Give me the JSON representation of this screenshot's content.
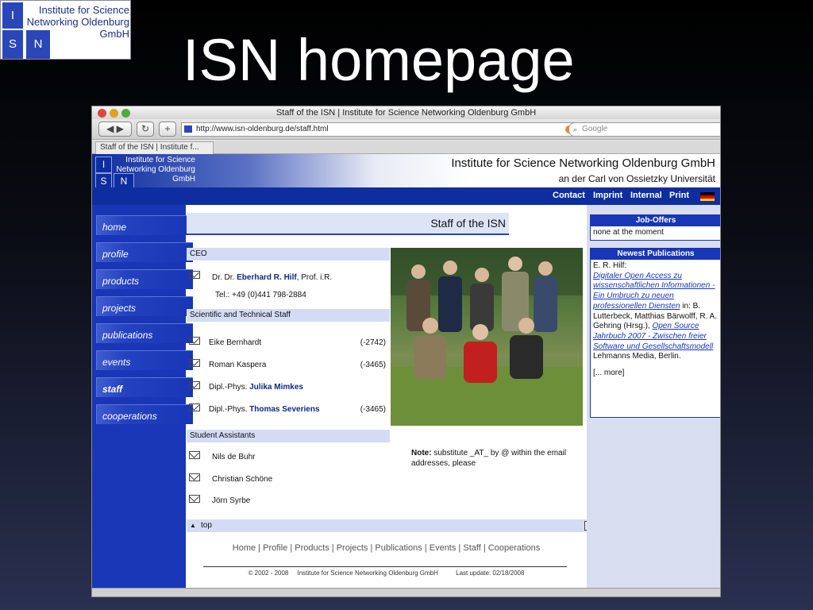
{
  "slide": {
    "logo": {
      "text": "Institute for Science\nNetworking Oldenburg\nGmbH",
      "cells": [
        "I",
        "S",
        "N"
      ]
    },
    "title": "ISN homepage"
  },
  "browser": {
    "window_title": "Staff of the ISN | Institute for Science Networking Oldenburg GmbH",
    "url": "http://www.isn-oldenburg.de/staff.html",
    "search_placeholder": "Google",
    "tab_label": "Staff of the ISN | Institute f..."
  },
  "site": {
    "logo_text": "Institute for Science\nNetworking Oldenburg\nGmbH",
    "logo_cells": [
      "I",
      "S",
      "N"
    ],
    "header_title": "Institute for Science Networking Oldenburg GmbH",
    "header_subtitle": "an der Carl von Ossietzky Universität",
    "top_nav": [
      "Contact",
      "Imprint",
      "Internal",
      "Print"
    ],
    "left_nav": [
      "home",
      "profile",
      "products",
      "projects",
      "publications",
      "events",
      "staff",
      "cooperations"
    ],
    "left_nav_active": "staff",
    "page_heading": "Staff of the ISN",
    "sections": {
      "ceo": "CEO",
      "scientific": "Scientific and Technical Staff",
      "students": "Student Assistants"
    },
    "ceo": {
      "prefix": "Dr. Dr. ",
      "name": "Eberhard R. Hilf",
      "suffix": ", Prof. i.R.",
      "tel": "Tel.: +49 (0)441 798-2884"
    },
    "staff": [
      {
        "prefix": "",
        "name": "Eike Bernhardt",
        "bold": false,
        "ext": "(-2742)"
      },
      {
        "prefix": "",
        "name": "Roman Kaspera",
        "bold": false,
        "ext": "(-3465)"
      },
      {
        "prefix": "Dipl.-Phys. ",
        "name": "Julika Mimkes",
        "bold": true,
        "ext": ""
      },
      {
        "prefix": "Dipl.-Phys. ",
        "name": "Thomas Severiens",
        "bold": true,
        "ext": "(-3465)"
      }
    ],
    "students": [
      "Nils de Buhr",
      "Christian Schöne",
      "Jörn Syrbe"
    ],
    "note_label": "Note:",
    "note_text": " substitute _AT_ by @ within the email addresses, please",
    "top_link": "top",
    "bottom_nav": [
      "Home",
      "Profile",
      "Products",
      "Projects",
      "Publications",
      "Events",
      "Staff",
      "Cooperations"
    ],
    "copyright": "© 2002 - 2008     Institute for Science Networking Oldenburg GmbH          Last update: 02/18/2008",
    "job_offers": {
      "title": "Job-Offers",
      "body": "none at the moment"
    },
    "publications": {
      "title": "Newest Publications",
      "author1": "E. R. Hilf:",
      "title1": "Digitaler Open Access zu wissenschaftlichen Informationen - Ein Umbruch zu neuen professionellen Diensten",
      "in": " in:",
      "editors": "B. Lutterbeck, Matthias Bärwolff, R. A. Gehring (Hrsg.), ",
      "title2": "Open Source Jahrbuch 2007 - Zwischen freier Software und Gesellschaftsmodell",
      "publisher": "Lehmanns Media, Berlin.",
      "more": "[... more]"
    }
  },
  "colors": {
    "site_blue": "#1836b5",
    "nav_blue": "#0e2ea0",
    "section_bg": "#d4dcf5"
  }
}
